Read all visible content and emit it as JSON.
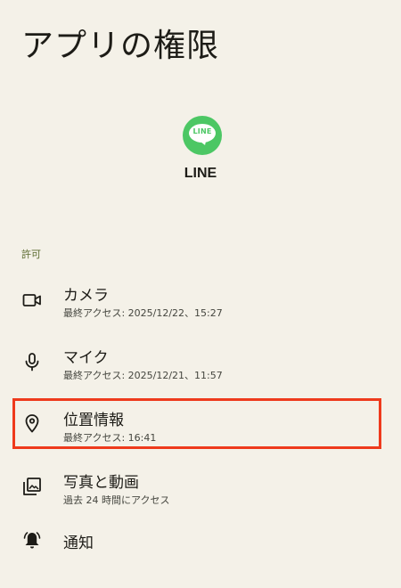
{
  "page": {
    "title": "アプリの権限"
  },
  "app": {
    "icon_logo_text": "LINE",
    "name": "LINE",
    "brand_color": "#4cc764"
  },
  "section": {
    "label": "許可"
  },
  "permissions": [
    {
      "icon": "camera-icon",
      "title": "カメラ",
      "subtitle": "最終アクセス: 2025/12/22、15:27"
    },
    {
      "icon": "microphone-icon",
      "title": "マイク",
      "subtitle": "最終アクセス: 2025/12/21、11:57"
    },
    {
      "icon": "location-icon",
      "title": "位置情報",
      "subtitle": "最終アクセス: 16:41",
      "highlighted": true
    },
    {
      "icon": "photos-icon",
      "title": "写真と動画",
      "subtitle": "過去 24 時間にアクセス"
    },
    {
      "icon": "bell-icon",
      "title": "通知",
      "subtitle": ""
    }
  ],
  "colors": {
    "background": "#f4f1e8",
    "section_label": "#5b6b2f",
    "highlight": "#ee3a1c"
  }
}
